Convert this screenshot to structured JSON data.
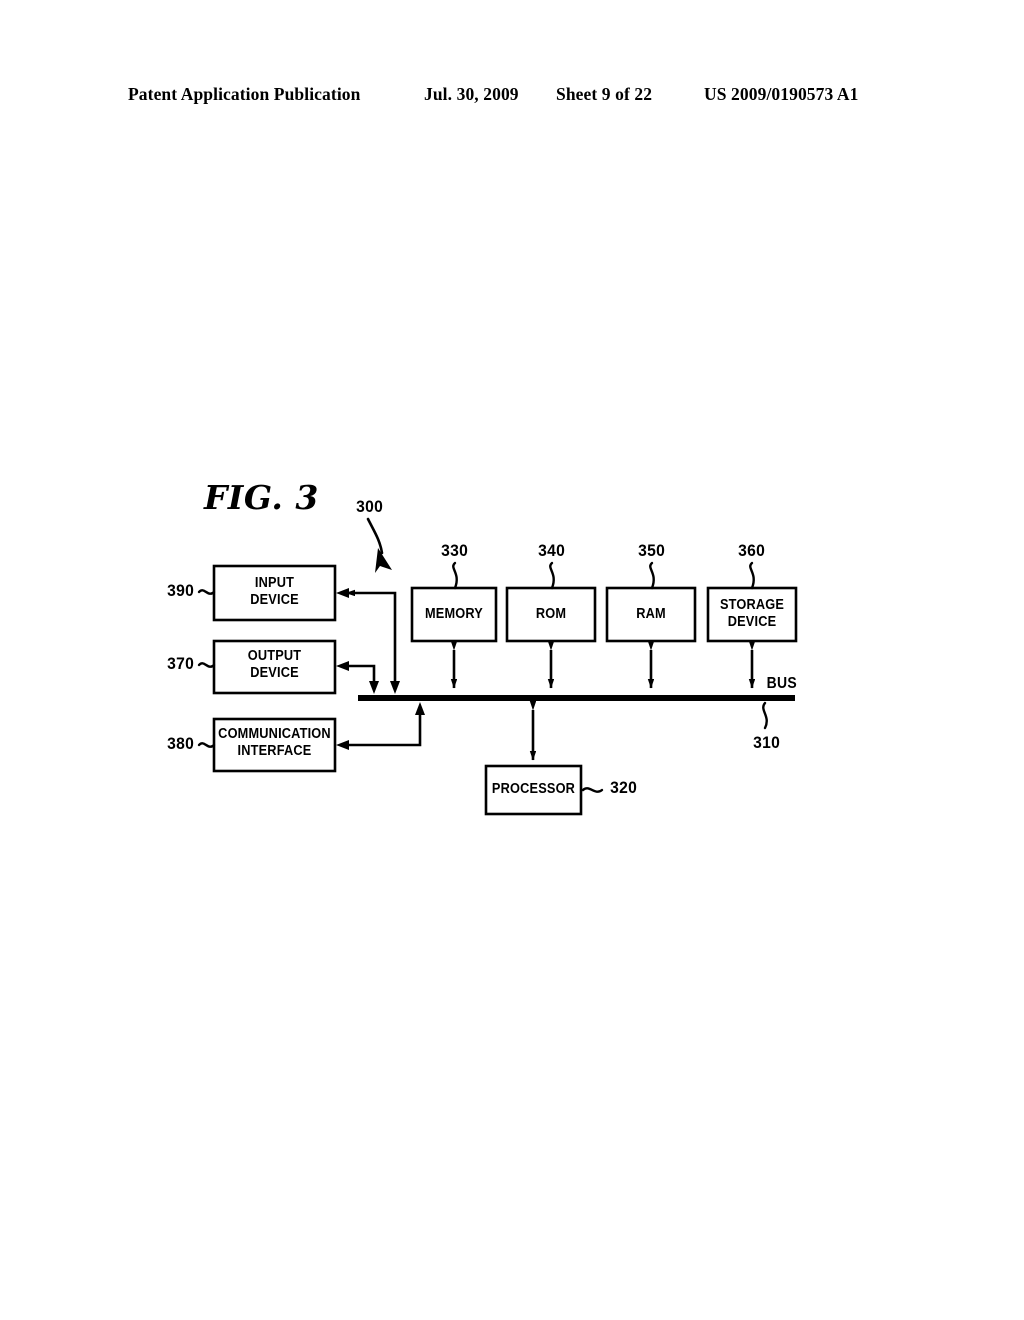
{
  "header": {
    "publication": "Patent Application Publication",
    "date": "Jul. 30, 2009",
    "sheet": "Sheet 9 of 22",
    "doc_number": "US 2009/0190573 A1"
  },
  "figure": {
    "caption": "FIG. 3",
    "system_ref": "300",
    "bus_label": "BUS",
    "boxes": [
      {
        "id": "input-device",
        "label": "INPUT\nDEVICE",
        "ref": "390"
      },
      {
        "id": "output-device",
        "label": "OUTPUT\nDEVICE",
        "ref": "370"
      },
      {
        "id": "communication-interface",
        "label": "COMMUNICATION\nINTERFACE",
        "ref": "380"
      },
      {
        "id": "memory",
        "label": "MEMORY",
        "ref": "330"
      },
      {
        "id": "rom",
        "label": "ROM",
        "ref": "340"
      },
      {
        "id": "ram",
        "label": "RAM",
        "ref": "350"
      },
      {
        "id": "storage-device",
        "label": "STORAGE\nDEVICE",
        "ref": "360"
      },
      {
        "id": "processor",
        "label": "PROCESSOR",
        "ref": "320"
      },
      {
        "id": "bus",
        "label": "BUS",
        "ref": "310"
      }
    ],
    "colors": {
      "ink": "#000000",
      "paper": "#ffffff"
    }
  }
}
